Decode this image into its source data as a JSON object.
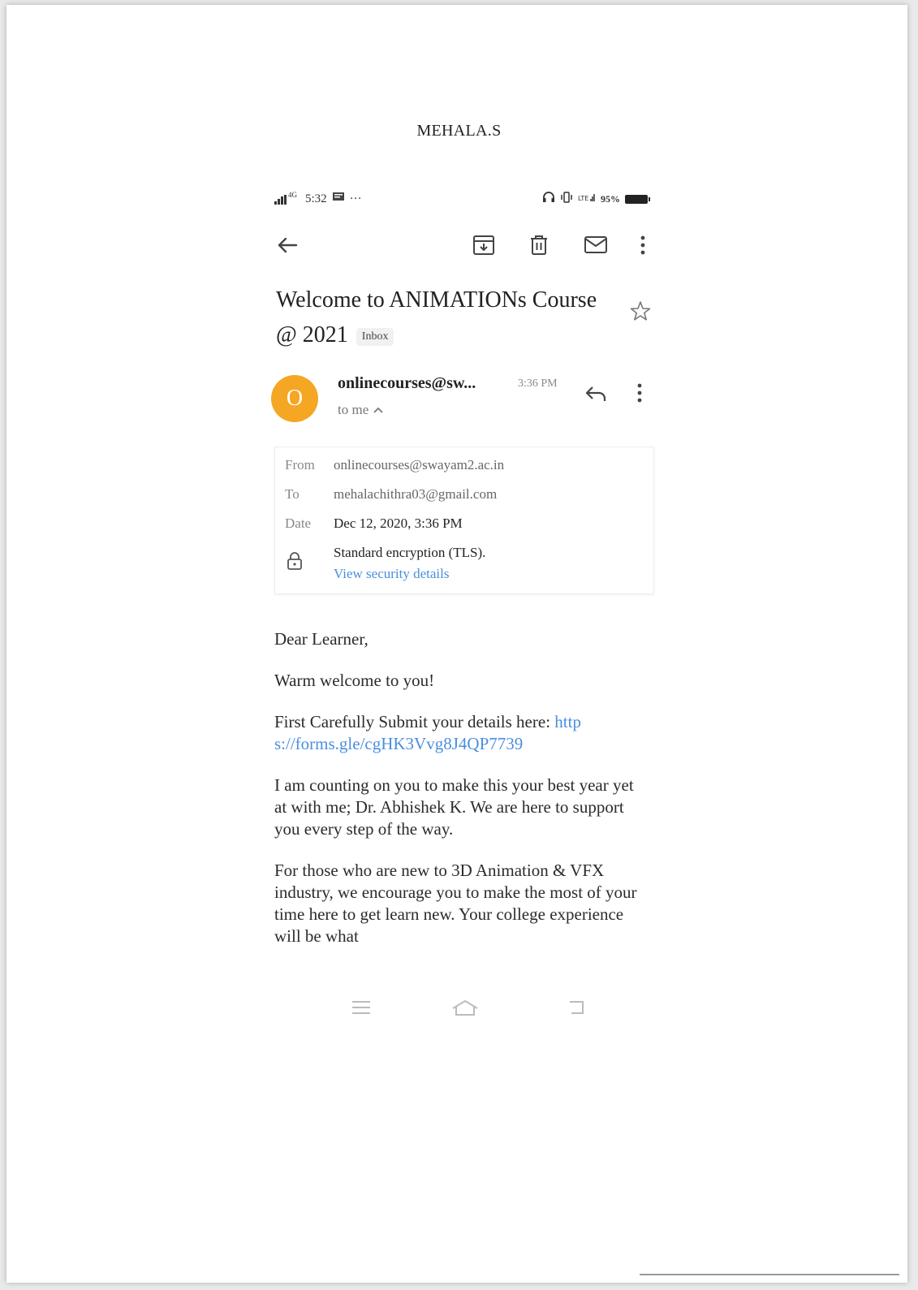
{
  "document": {
    "title": "MEHALA.S"
  },
  "status_bar": {
    "network": "4G",
    "time": "5:32",
    "extra": "···",
    "right_text": "95%"
  },
  "email": {
    "subject": "Welcome to ANIMATIONs Course @ 2021",
    "label": "Inbox",
    "avatar_initial": "O",
    "sender_display": "onlinecourses@sw...",
    "sent_time": "3:36 PM",
    "recipient_summary": "to me",
    "details": {
      "from_label": "From",
      "from_value": "onlinecourses@swayam2.ac.in",
      "to_label": "To",
      "to_value": "mehalachithra03@gmail.com",
      "date_label": "Date",
      "date_value": "Dec 12, 2020, 3:36 PM",
      "encryption": "Standard encryption (TLS).",
      "security_link": "View security details"
    },
    "body": {
      "greeting": "Dear Learner,",
      "welcome": "Warm welcome to you!",
      "submit_text": "First Carefully Submit your details here: ",
      "form_link": "https://forms.gle/cgHK3Vvg8J4QP7739",
      "para1": "I am counting on you to make this your best year yet at with me; Dr. Abhishek K. We are here to support you every step of the way.",
      "para2": "For those who are new to 3D Animation & VFX industry, we encourage you to make the most of your time here to get learn new. Your college experience will be what"
    }
  },
  "colors": {
    "avatar": "#f5a623",
    "link": "#4a8fe0"
  },
  "icons": [
    "back-arrow-icon",
    "archive-icon",
    "delete-icon",
    "mail-icon",
    "more-vert-icon",
    "star-icon",
    "reply-icon",
    "lock-icon",
    "menu-icon",
    "home-icon",
    "recents-icon"
  ]
}
